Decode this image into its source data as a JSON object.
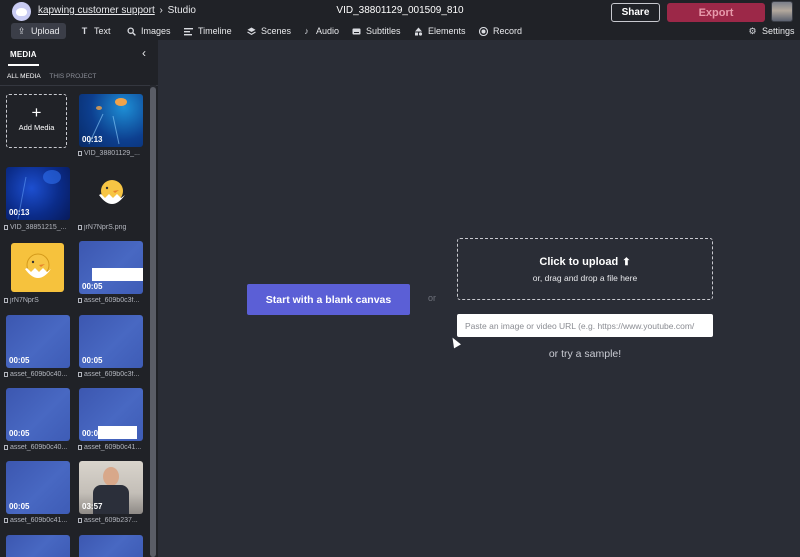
{
  "header": {
    "workspace": "kapwing customer support",
    "separator": "›",
    "section": "Studio",
    "document_title": "VID_38801129_001509_810",
    "share_label": "Share",
    "export_label": "Export",
    "accent_color": "#9c2848"
  },
  "toolbar": {
    "items": [
      {
        "label": "Upload",
        "icon": "upload-icon"
      },
      {
        "label": "Text",
        "icon": "text-icon"
      },
      {
        "label": "Images",
        "icon": "search-icon"
      },
      {
        "label": "Timeline",
        "icon": "timeline-icon"
      },
      {
        "label": "Scenes",
        "icon": "layers-icon"
      },
      {
        "label": "Audio",
        "icon": "music-note-icon"
      },
      {
        "label": "Subtitles",
        "icon": "subtitles-icon"
      },
      {
        "label": "Elements",
        "icon": "shapes-icon"
      },
      {
        "label": "Record",
        "icon": "record-icon"
      }
    ],
    "settings_label": "Settings"
  },
  "sidebar": {
    "title": "MEDIA",
    "tabs": [
      "ALL MEDIA",
      "THIS PROJECT"
    ],
    "add_media_label": "Add Media",
    "items": [
      {
        "duration": "00:13",
        "caption": "VID_38801129_..."
      },
      {
        "duration": "00:13",
        "caption": "VID_38851215_..."
      },
      {
        "duration": "",
        "caption": "jrN7NprS.png"
      },
      {
        "duration": "",
        "caption": "jrN7NprS"
      },
      {
        "duration": "00:05",
        "caption": "asset_609b0c3f..."
      },
      {
        "duration": "00:05",
        "caption": "asset_609b0c40..."
      },
      {
        "duration": "00:05",
        "caption": "asset_609b0c3f..."
      },
      {
        "duration": "00:05",
        "caption": "asset_609b0c40..."
      },
      {
        "duration": "00:0",
        "caption": "asset_609b0c41..."
      },
      {
        "duration": "00:05",
        "caption": "asset_609b0c41..."
      },
      {
        "duration": "03:57",
        "caption": "asset_609b237..."
      }
    ]
  },
  "main": {
    "blank_canvas_label": "Start with a blank canvas",
    "or_label": "or",
    "upload_title": "Click to upload",
    "upload_subtitle": "or, drag and drop a file here",
    "url_placeholder": "Paste an image or video URL (e.g. https://www.youtube.com/",
    "sample_label": "or try a sample!",
    "primary_color": "#5b5fd6"
  }
}
